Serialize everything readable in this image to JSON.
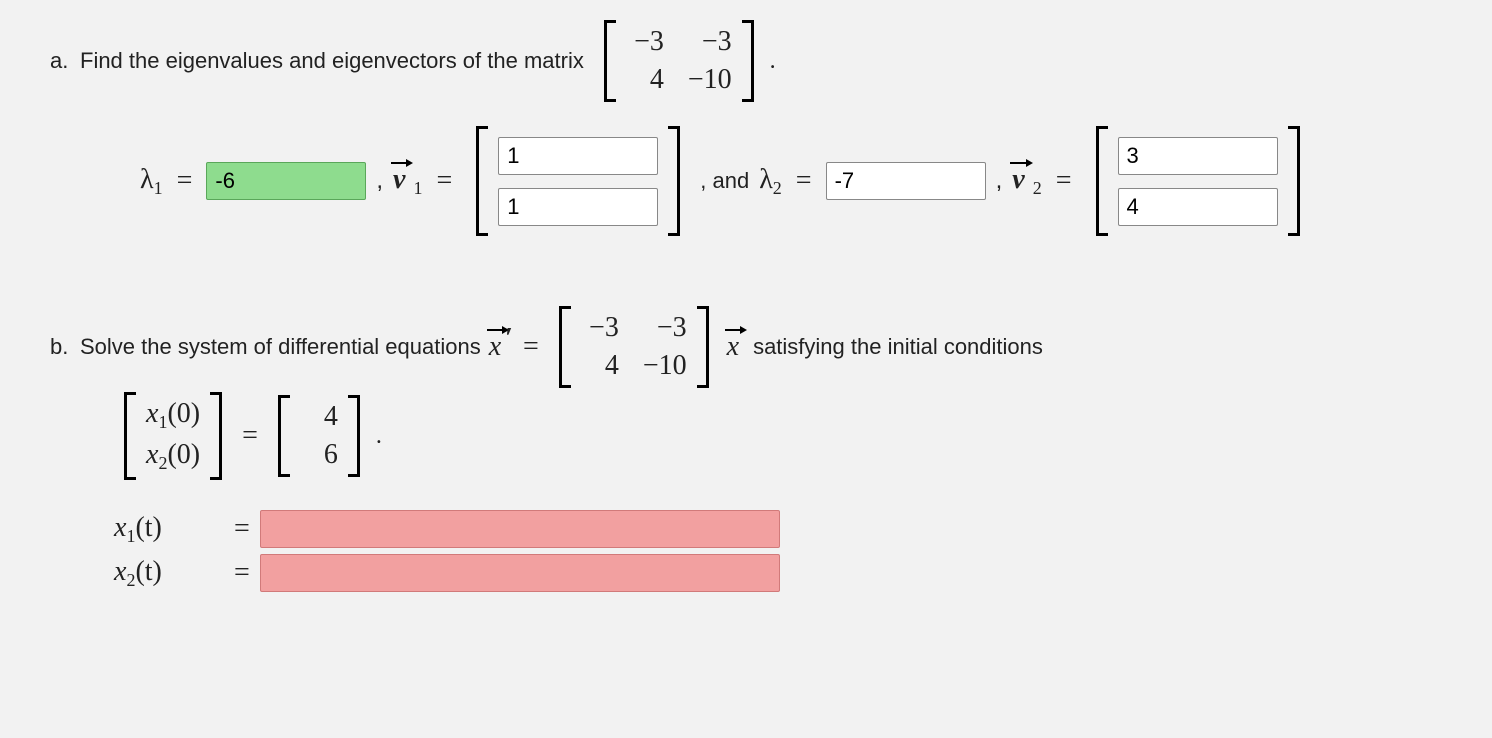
{
  "partA": {
    "letter": "a.",
    "prompt": "Find the eigenvalues and eigenvectors of the matrix",
    "matrix": {
      "r1c1": "−3",
      "r1c2": "−3",
      "r2c1": "4",
      "r2c2": "−10"
    },
    "lambda1_label_prefix": "λ",
    "lambda1_sub": "1",
    "lambda1_value": "-6",
    "v1_label": "v",
    "v1_sub": "1",
    "v1_top": "1",
    "v1_bottom": "1",
    "and_text": ", and",
    "lambda2_sub": "2",
    "lambda2_value": "-7",
    "v2_sub": "2",
    "v2_top": "3",
    "v2_bottom": "4",
    "comma": ","
  },
  "partB": {
    "letter": "b.",
    "prompt_before": "Solve the system of differential equations",
    "xprime": "x",
    "matrix": {
      "r1c1": "−3",
      "r1c2": "−3",
      "r2c1": "4",
      "r2c2": "−10"
    },
    "x_after": "x",
    "prompt_after": "satisfying the initial conditions",
    "ic_left": {
      "top": "x",
      "top_sub": "1",
      "top_arg": "(0)",
      "bot": "x",
      "bot_sub": "2",
      "bot_arg": "(0)"
    },
    "ic_right": {
      "top": "4",
      "bot": "6"
    },
    "x1t_label": "x",
    "x1t_sub": "1",
    "x1t_arg": "(t)",
    "x2t_label": "x",
    "x2t_sub": "2",
    "x2t_arg": "(t)",
    "x1t_value": "",
    "x2t_value": ""
  },
  "colors": {
    "correct_bg": "#8edc8e",
    "wrong_bg": "#f2a0a0"
  }
}
